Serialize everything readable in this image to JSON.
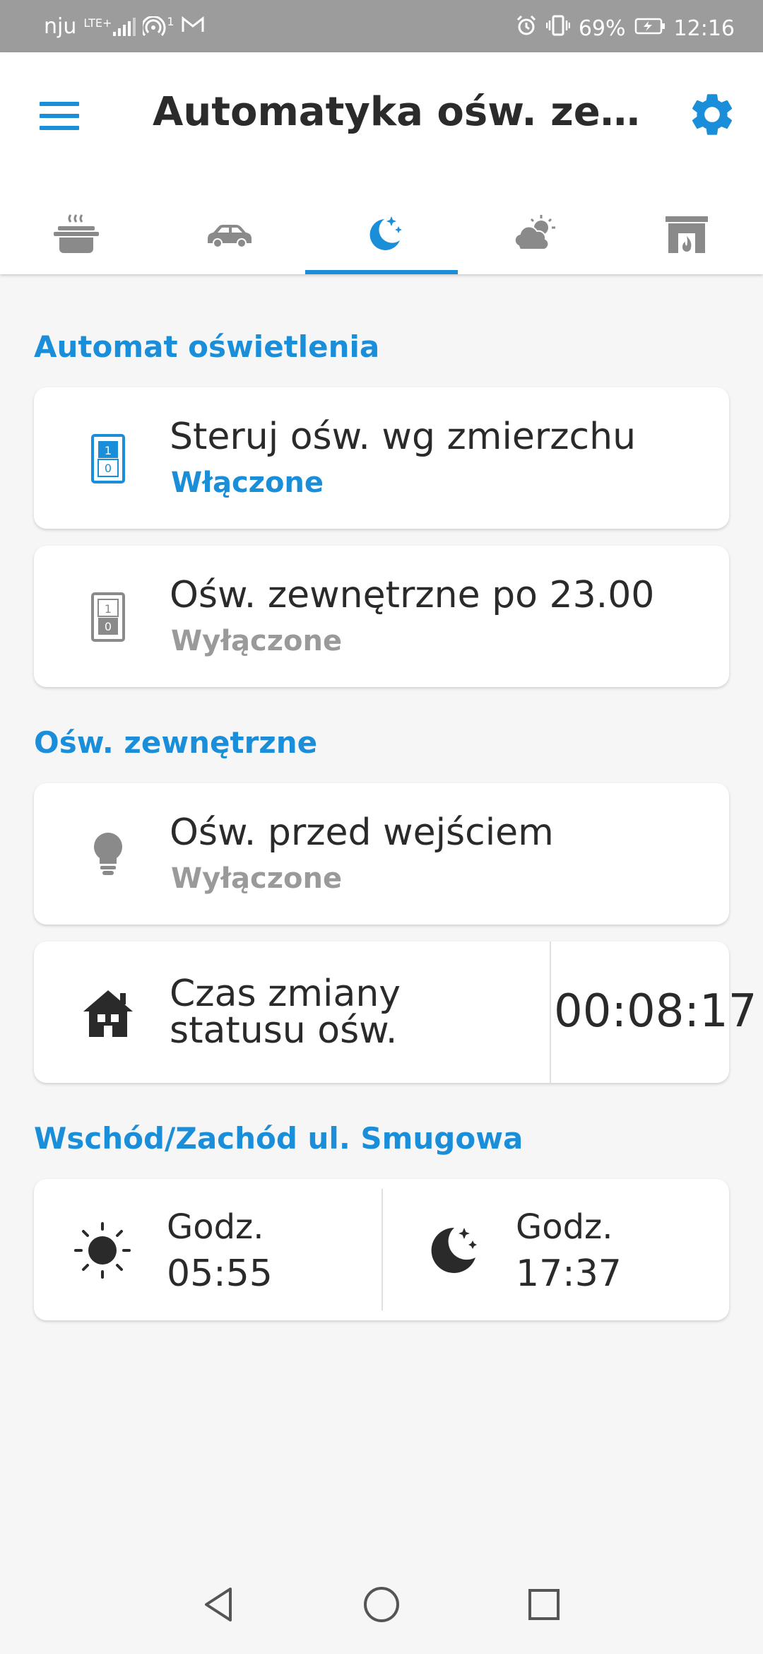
{
  "status_bar": {
    "carrier": "nju",
    "network": "LTE+",
    "hotspot_count": "1",
    "battery": "69%",
    "time": "12:16",
    "icons": [
      "signal-icon",
      "hotspot-icon",
      "gmail-icon",
      "alarm-icon",
      "vibrate-icon",
      "battery-icon"
    ]
  },
  "header": {
    "title": "Automatyka ośw. zewnętrzne",
    "menu_icon": "hamburger-icon",
    "settings_icon": "gear-icon"
  },
  "tabs": [
    {
      "icon": "cooking-pot-icon",
      "active": false
    },
    {
      "icon": "car-icon",
      "active": false
    },
    {
      "icon": "moon-stars-icon",
      "active": true
    },
    {
      "icon": "cloud-sun-icon",
      "active": false
    },
    {
      "icon": "fireplace-icon",
      "active": false
    }
  ],
  "sections": {
    "automat": {
      "title": "Automat oświetlenia",
      "items": [
        {
          "label": "Steruj ośw. wg zmierzchu",
          "status": "Włączone",
          "icon": "switch-on-icon"
        },
        {
          "label": "Ośw. zewnętrzne po 23.00",
          "status": "Wyłączone",
          "icon": "switch-off-icon"
        }
      ]
    },
    "outdoor": {
      "title": "Ośw. zewnętrzne",
      "items": [
        {
          "label": "Ośw. przed wejściem",
          "status": "Wyłączone",
          "icon": "light-bulb-icon"
        },
        {
          "label": "Czas zmiany statusu ośw.",
          "value": "00:08:17",
          "icon": "house-icon"
        }
      ]
    },
    "sun": {
      "title": "Wschód/Zachód ul. Smugowa",
      "sunrise": {
        "label": "Godz.",
        "value": "05:55",
        "icon": "sun-icon"
      },
      "sunset": {
        "label": "Godz.",
        "value": "17:37",
        "icon": "moon-icon"
      }
    }
  },
  "colors": {
    "accent": "#1a8ed8",
    "status_bar": "#9c9c9c",
    "background": "#f6f6f6",
    "inactive_icon": "#8a8a8a",
    "off_text": "#9a9a9a"
  },
  "nav_bar": {
    "buttons": [
      "back-icon",
      "home-icon",
      "recents-icon"
    ]
  }
}
